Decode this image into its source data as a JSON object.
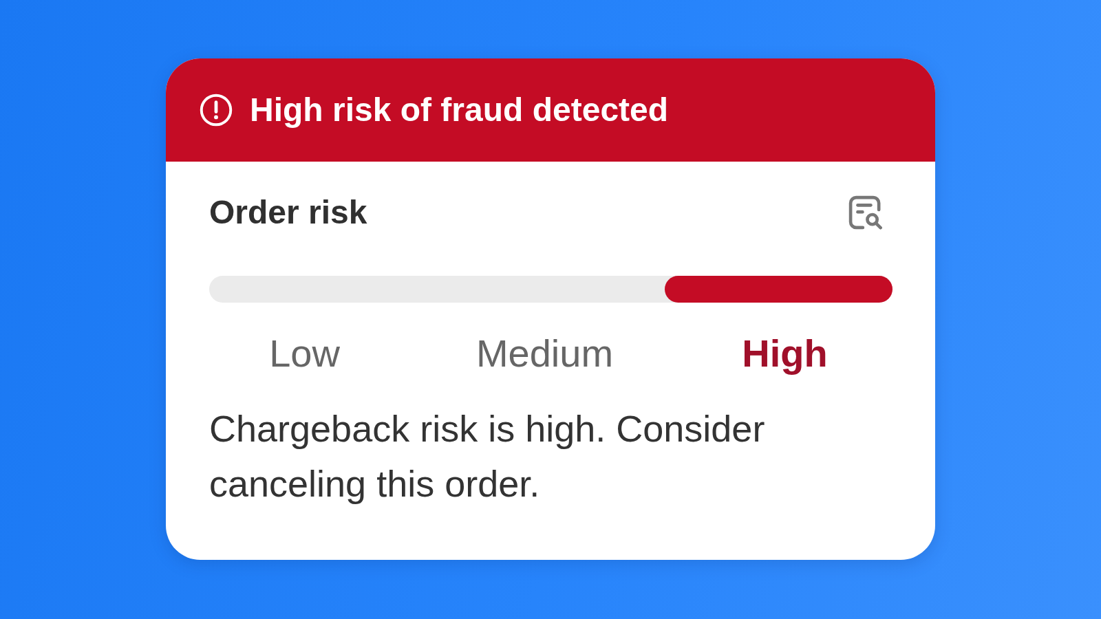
{
  "banner": {
    "kind": "danger",
    "title": "High risk of fraud detected"
  },
  "risk": {
    "title": "Order risk",
    "levels": [
      {
        "label": "Low",
        "selected": false
      },
      {
        "label": "Medium",
        "selected": false
      },
      {
        "label": "High",
        "selected": true
      }
    ],
    "message": "Chargeback risk is high. Consider canceling this order."
  }
}
